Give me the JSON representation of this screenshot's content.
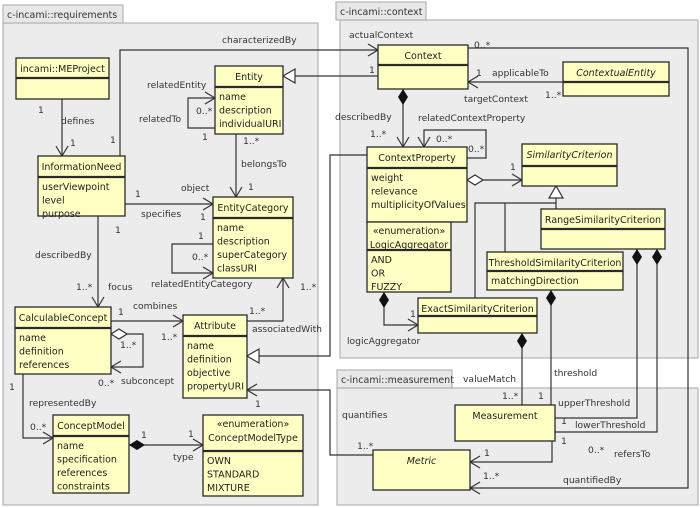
{
  "packages": [
    {
      "id": "requirements",
      "name": "c-incami::requirements"
    },
    {
      "id": "context",
      "name": "c-incami::context"
    },
    {
      "id": "measurement",
      "name": "c-incami::measurement"
    }
  ],
  "classes": [
    {
      "id": "meproject",
      "name": "incami::MEProject",
      "attributes": []
    },
    {
      "id": "entity",
      "name": "Entity",
      "attributes": [
        "name",
        "description",
        "individualURI"
      ]
    },
    {
      "id": "informationneed",
      "name": "InformationNeed",
      "attributes": [
        "userViewpoint",
        "level",
        "purpose"
      ]
    },
    {
      "id": "entitycategory",
      "name": "EntityCategory",
      "attributes": [
        "name",
        "description",
        "superCategory",
        "classURI"
      ]
    },
    {
      "id": "calculableconcept",
      "name": "CalculableConcept",
      "attributes": [
        "name",
        "definition",
        "references"
      ]
    },
    {
      "id": "attribute",
      "name": "Attribute",
      "attributes": [
        "name",
        "definition",
        "objective",
        "propertyURI"
      ]
    },
    {
      "id": "conceptmodel",
      "name": "ConceptModel",
      "attributes": [
        "name",
        "specification",
        "references",
        "constraints"
      ]
    },
    {
      "id": "conceptmodeltype",
      "stereotype": "«enumeration»",
      "name": "ConceptModelType",
      "attributes": [
        "OWN",
        "STANDARD",
        "MIXTURE"
      ]
    },
    {
      "id": "context",
      "name": "Context",
      "attributes": []
    },
    {
      "id": "contextualentity",
      "name": "ContextualEntity",
      "italic": true,
      "attributes": []
    },
    {
      "id": "contextproperty",
      "name": "ContextProperty",
      "attributes": [
        "weight",
        "relevance",
        "multiplicityOfValues"
      ]
    },
    {
      "id": "similaritycriterion",
      "name": "SimilarityCriterion",
      "italic": true,
      "attributes": []
    },
    {
      "id": "rangesimilaritycriterion",
      "name": "RangeSimilarityCriterion",
      "attributes": []
    },
    {
      "id": "logicaggregator",
      "stereotype": "«enumeration»",
      "name": "LogicAggregator",
      "attributes": [
        "AND",
        "OR",
        "FUZZY"
      ]
    },
    {
      "id": "thresholdsimilaritycriterion",
      "name": "ThresholdSimilarityCriterion",
      "attributes": [
        "matchingDirection"
      ]
    },
    {
      "id": "exactsimilaritycriterion",
      "name": "ExactSimilarityCriterion",
      "attributes": []
    },
    {
      "id": "measurement",
      "name": "Measurement",
      "noCompartment": true,
      "attributes": []
    },
    {
      "id": "metric",
      "name": "Metric",
      "italic": true,
      "noCompartment": true,
      "attributes": []
    }
  ],
  "labels": [
    "characterizedBy",
    "1",
    "defines",
    "1",
    "1",
    "relatedEntity",
    "relatedTo",
    "0..*",
    "1",
    "1..*",
    "belongsTo",
    "1",
    "object",
    "1",
    "specifies",
    "1",
    "1",
    "1",
    "0..*",
    "relatedEntityCategory",
    "describedBy",
    "1..*",
    "focus",
    "1..*",
    "combines",
    "1",
    "1..*",
    "associatedWith",
    "1..*",
    "1..*",
    "0..*",
    "subconcept",
    "1",
    "representedBy",
    "0..*",
    "1",
    "1",
    "type",
    "1",
    "actualContext",
    "0..*",
    "1",
    "1",
    "applicableTo",
    "targetContext",
    "1..*",
    "describedBy",
    "relatedContextProperty",
    "1..*",
    "0..*",
    "0..*",
    "1",
    "logicAggregator",
    "1",
    "valueMatch",
    "threshold",
    "1..*",
    "1",
    "upperThreshold",
    "1",
    "lowerThreshold",
    "1",
    "0..*",
    "refersTo",
    "1",
    "1..*",
    "quantifiedBy",
    "quantifies",
    "1..*"
  ],
  "colors": {
    "class_fill": "#ffffc4",
    "package_fill": "#ececec"
  }
}
